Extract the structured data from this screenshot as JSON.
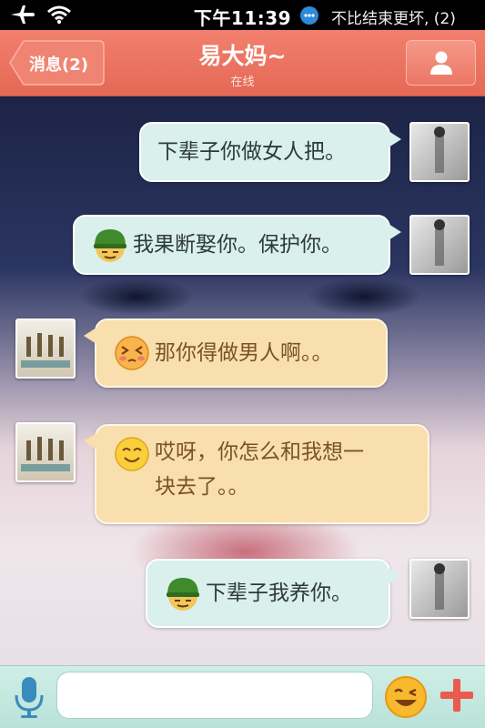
{
  "status_bar": {
    "time": "下午11:39",
    "notification": "不比结束更坏, (2)"
  },
  "nav": {
    "back_label": "消息(2)",
    "title": "易大妈~",
    "subtitle": "在线"
  },
  "messages": [
    {
      "side": "out",
      "emoji": "",
      "text": "下辈子你做女人把。"
    },
    {
      "side": "out",
      "emoji": "soldier-face",
      "text": "我果断娶你。保护你。"
    },
    {
      "side": "in",
      "emoji": "blushing-face",
      "text": "那你得做男人啊。。"
    },
    {
      "side": "in",
      "emoji": "smiling-face",
      "text": "哎呀，你怎么和我想一\n块去了。。"
    },
    {
      "side": "out",
      "emoji": "soldier-face",
      "text": "下辈子我养你。"
    }
  ],
  "input": {
    "placeholder": "",
    "value": ""
  },
  "icons": {
    "status": [
      "airplane-icon",
      "wifi-icon",
      "notification-icon"
    ],
    "nav": [
      "back-arrow-icon",
      "person-icon"
    ],
    "input_bar": [
      "microphone-icon",
      "emoji-icon",
      "plus-icon"
    ]
  },
  "colors": {
    "nav_bar": "#e46956",
    "outgoing_bubble": "#d9f0ec",
    "incoming_bubble": "#f8dfad",
    "input_bar": "#c4e8df"
  }
}
